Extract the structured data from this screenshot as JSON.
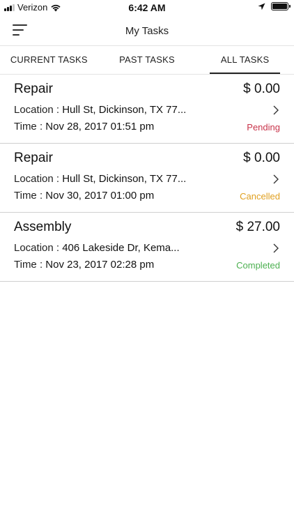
{
  "status_bar": {
    "carrier": "Verizon",
    "time": "6:42 AM"
  },
  "nav": {
    "title": "My Tasks"
  },
  "tabs": [
    {
      "label": "CURRENT TASKS",
      "active": false
    },
    {
      "label": "PAST TASKS",
      "active": false
    },
    {
      "label": "ALL TASKS",
      "active": true
    }
  ],
  "labels": {
    "location": "Location : ",
    "time": "Time : "
  },
  "tasks": [
    {
      "type": "Repair",
      "price": "$ 0.00",
      "location": "Hull St, Dickinson, TX 77...",
      "time": "Nov 28, 2017 01:51 pm",
      "status": "Pending",
      "status_color": "#c8334a"
    },
    {
      "type": "Repair",
      "price": "$ 0.00",
      "location": "Hull St, Dickinson, TX 77...",
      "time": "Nov 30, 2017 01:00 pm",
      "status": "Cancelled",
      "status_color": "#e0a020"
    },
    {
      "type": "Assembly",
      "price": "$ 27.00",
      "location": "406 Lakeside Dr, Kema...",
      "time": "Nov 23, 2017 02:28 pm",
      "status": "Completed",
      "status_color": "#4cb050"
    }
  ]
}
